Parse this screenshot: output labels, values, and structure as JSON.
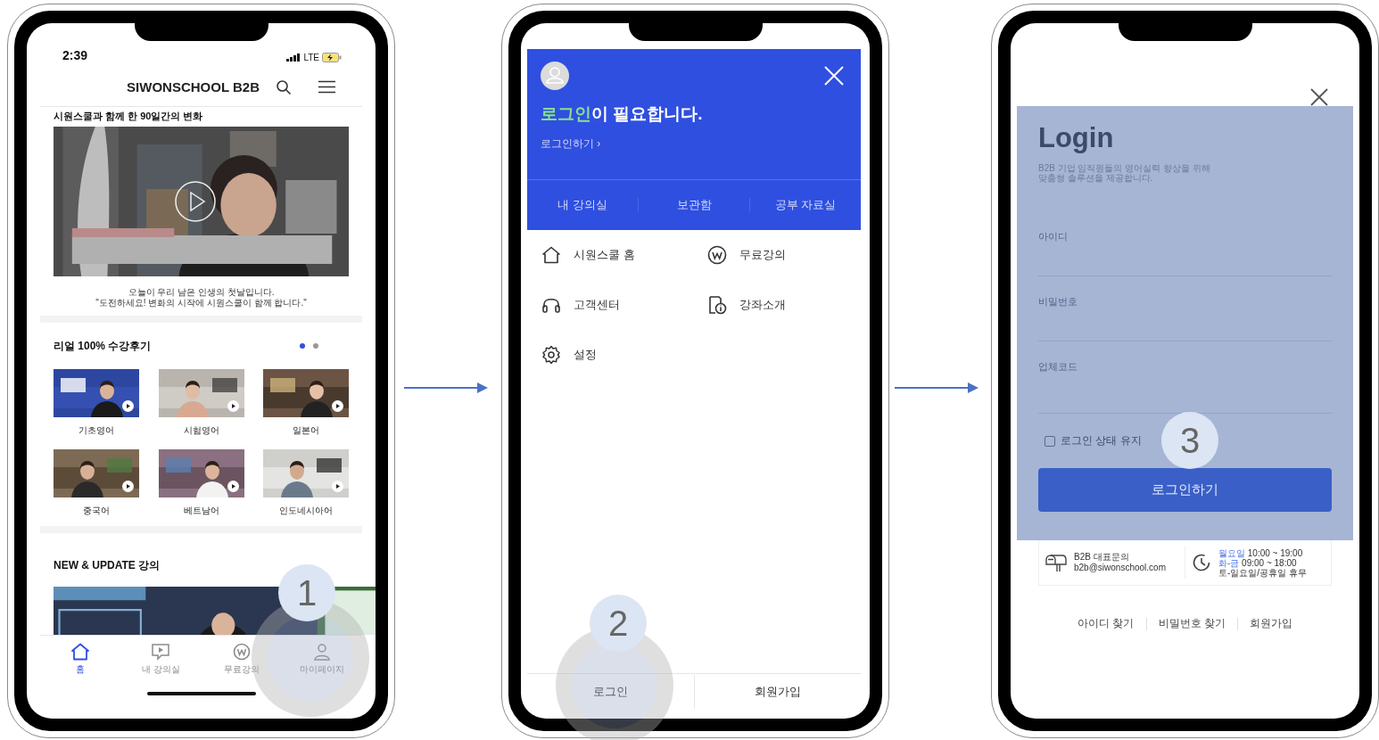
{
  "home_screen": {
    "status_bar": {
      "time": "2:39",
      "network": "LTE"
    },
    "header": {
      "title": "SIWONSCHOOL B2B"
    },
    "video_section": {
      "heading": "시원스쿨과 함께 한 90일간의 변화",
      "caption": [
        "오늘이 우리 남은 인생의 첫날입니다.",
        "\"도전하세요! 변화의 시작에 시원스쿨이 함께 합니다.\""
      ]
    },
    "reviews": {
      "heading": "리얼 100% 수강후기",
      "pages": [
        {
          "selected": true
        },
        {
          "selected": false
        }
      ],
      "items": [
        {
          "label": "기초영어"
        },
        {
          "label": "시험영어"
        },
        {
          "label": "일본어"
        },
        {
          "label": "중국어"
        },
        {
          "label": "베트남어"
        },
        {
          "label": "인도네시아어"
        }
      ]
    },
    "new_section": {
      "heading": "NEW & UPDATE 강의"
    },
    "tab_bar": [
      {
        "kind": "home",
        "label": "홈",
        "selected": true
      },
      {
        "kind": "classroom",
        "label": "내 강의실",
        "selected": false
      },
      {
        "kind": "free",
        "label": "무료강의",
        "selected": false
      },
      {
        "kind": "mypage",
        "label": "마이페이지",
        "selected": false
      }
    ],
    "annotation": {
      "label": "1",
      "tap_ring": true
    }
  },
  "menu_screen": {
    "title": {
      "highlight": "로그인",
      "rest": "이 필요합니다."
    },
    "login_link": "로그인하기 ›",
    "tabs": [
      "내 강의실",
      "보관함",
      "공부 자료실"
    ],
    "menu_items": [
      {
        "kind": "home",
        "label": "시원스쿨 홈"
      },
      {
        "kind": "free",
        "label": "무료강의"
      },
      {
        "kind": "support",
        "label": "고객센터"
      },
      {
        "kind": "course",
        "label": "강좌소개"
      },
      {
        "kind": "settings",
        "label": "설정"
      }
    ],
    "bottom_buttons": [
      "로그인",
      "회원가입"
    ],
    "annotation": {
      "label": "2",
      "tap_ring": true
    }
  },
  "login_screen": {
    "title": "Login",
    "description": [
      "B2B 기업 임직원들의 영어실력 향상을 위해",
      "맞춤형 솔루션을 제공합니다."
    ],
    "fields": [
      {
        "placeholder": "아이디"
      },
      {
        "placeholder": "비밀번호"
      },
      {
        "placeholder": "업체코드"
      }
    ],
    "remember": {
      "label": "로그인 상태 유지",
      "checked": false
    },
    "login_button": "로그인하기",
    "contact": {
      "title": "B2B 대표문의",
      "email": "b2b@siwonschool.com"
    },
    "hours": [
      {
        "kind": "open",
        "day": "월요일",
        "time": "10:00 ~ 19:00"
      },
      {
        "kind": "open",
        "day": "화-금",
        "time": "09:00 ~ 18:00"
      },
      {
        "kind": "closed",
        "day": "토-일요일/공휴일 휴무"
      }
    ],
    "links": [
      "아이디 찾기",
      "비밀번호 찾기",
      "회원가입"
    ],
    "annotation": {
      "label": "3",
      "tap_ring": false
    }
  }
}
